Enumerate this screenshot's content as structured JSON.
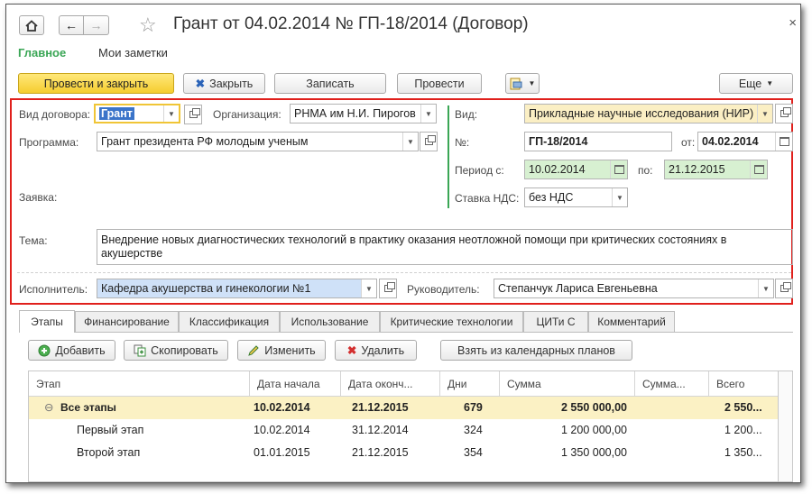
{
  "window": {
    "title": "Грант от 04.02.2014 № ГП-18/2014 (Договор)"
  },
  "nav_tabs": [
    "Главное",
    "Мои заметки"
  ],
  "toolbar": {
    "post_close": "Провести и закрыть",
    "close": "Закрыть",
    "save": "Записать",
    "post": "Провести",
    "more": "Еще"
  },
  "form": {
    "contract_type_label": "Вид договора:",
    "contract_type_value": "Грант",
    "organization_label": "Организация:",
    "organization_value": "РНМА им Н.И. Пирогов",
    "program_label": "Программа:",
    "program_value": "Грант президента РФ молодым ученым",
    "request_label": "Заявка:",
    "kind_label": "Вид:",
    "kind_value": "Прикладные научные исследования (НИР)",
    "number_label": "№:",
    "number_value": "ГП-18/2014",
    "date_from_label": "от:",
    "date_value": "04.02.2014",
    "period_label": "Период с:",
    "period_from": "10.02.2014",
    "period_to_label": "по:",
    "period_to": "21.12.2015",
    "vat_label": "Ставка НДС:",
    "vat_value": "без НДС",
    "topic_label": "Тема:",
    "topic_value": "Внедрение новых диагностических технологий в практику оказания неотложной помощи при критических состояниях в акушерстве",
    "executor_label": "Исполнитель:",
    "executor_value": "Кафедра акушерства и гинекологии №1",
    "manager_label": "Руководитель:",
    "manager_value": "Степанчук Лариса Евгеньевна"
  },
  "section_tabs": [
    "Этапы",
    "Финансирование",
    "Классификация",
    "Использование",
    "Критические технологии",
    "ЦИТи С",
    "Комментарий"
  ],
  "stage_toolbar": {
    "add": "Добавить",
    "copy": "Скопировать",
    "edit": "Изменить",
    "delete": "Удалить",
    "from_plans": "Взять из календарных планов"
  },
  "table": {
    "headers": [
      "Этап",
      "Дата начала",
      "Дата оконч...",
      "Дни",
      "Сумма",
      "Сумма...",
      "Всего"
    ],
    "rows": [
      {
        "name": "Все этапы",
        "start": "10.02.2014",
        "end": "21.12.2015",
        "days": "679",
        "sum": "2 550 000,00",
        "sum2": "",
        "total": "2 550..."
      },
      {
        "name": "Первый этап",
        "start": "10.02.2014",
        "end": "31.12.2014",
        "days": "324",
        "sum": "1 200 000,00",
        "sum2": "",
        "total": "1 200..."
      },
      {
        "name": "Второй этап",
        "start": "01.01.2015",
        "end": "21.12.2015",
        "days": "354",
        "sum": "1 350 000,00",
        "sum2": "",
        "total": "1 350..."
      }
    ]
  },
  "colors": {
    "accent_green": "#3aa655",
    "highlight_red": "#e0201c",
    "primary_yellow": "#f5cd2f",
    "group_row": "#fbf1c4",
    "selected_field": "#cfe1f8",
    "kind_field": "#fbefc4",
    "period_field": "#d7f0d1"
  }
}
